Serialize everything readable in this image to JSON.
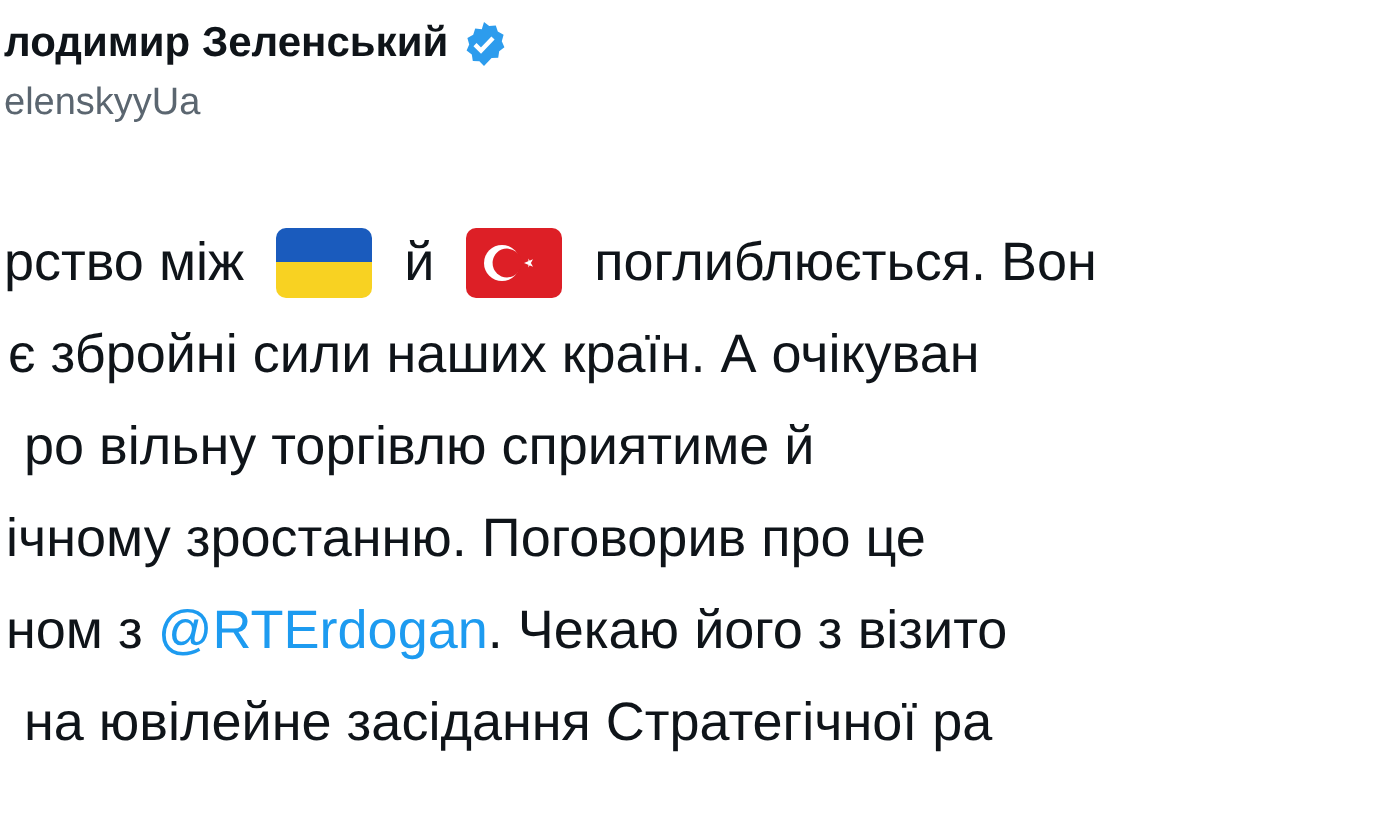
{
  "author": {
    "name": "лодимир Зеленський",
    "verified": true,
    "handle": "elenskyyUa"
  },
  "lines": [
    [
      {
        "kind": "text",
        "text": "рство між"
      },
      {
        "kind": "ukraine-flag"
      },
      {
        "kind": "text",
        "text": "й"
      },
      {
        "kind": "turkey-flag"
      },
      {
        "kind": "text",
        "text": "поглиблюється. Вон"
      }
    ],
    [
      {
        "kind": "text",
        "text": "є збройні сили наших країн. А очікуван"
      }
    ],
    [
      {
        "kind": "text",
        "text": "ро вільну торгівлю сприятиме й"
      }
    ],
    [
      {
        "kind": "text",
        "text": "ічному зростанню. Поговорив про це"
      }
    ],
    [
      {
        "kind": "text",
        "text": "ном з "
      },
      {
        "kind": "mention",
        "text": "@RTErdogan"
      },
      {
        "kind": "text",
        "text": ". Чекаю його з візито"
      }
    ],
    [
      {
        "kind": "text",
        "text": "на ювілейне засідання Стратегічної ра"
      }
    ]
  ]
}
